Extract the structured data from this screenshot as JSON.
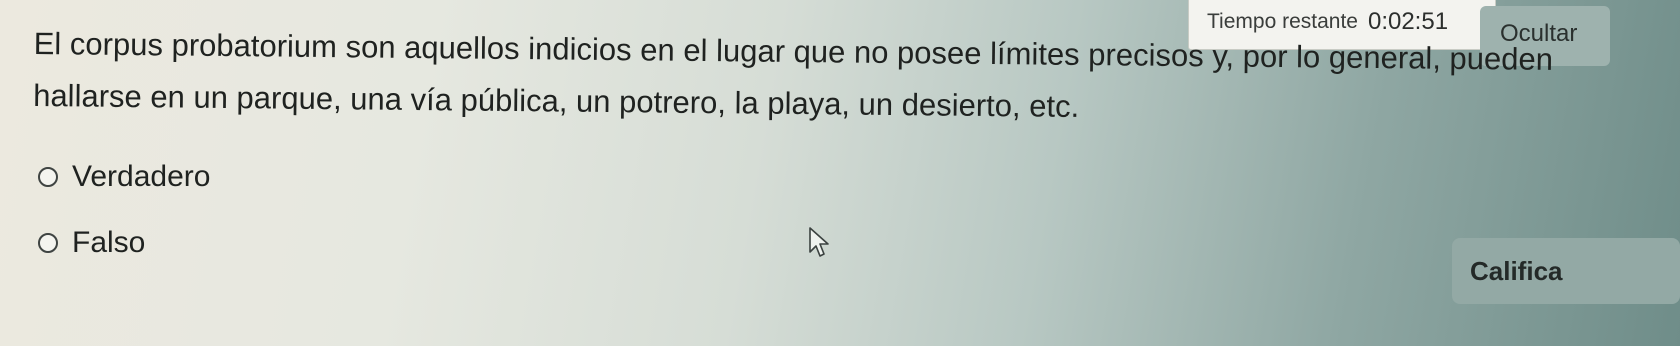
{
  "timer": {
    "label": "Tiempo restante",
    "value": "0:02:51"
  },
  "hide_button": {
    "label": "Ocultar"
  },
  "question": {
    "text": "El corpus probatorium son aquellos indicios en el lugar que no posee límites precisos y, por lo general, pueden hallarse en un parque, una vía pública, un potrero, la playa, un desierto, etc."
  },
  "options": [
    {
      "label": "Verdadero",
      "selected": false
    },
    {
      "label": "Falso",
      "selected": false
    }
  ],
  "submit_button": {
    "label": "Califica"
  },
  "icons": {
    "radio": "radio-circle-icon",
    "cursor": "mouse-pointer-icon"
  }
}
